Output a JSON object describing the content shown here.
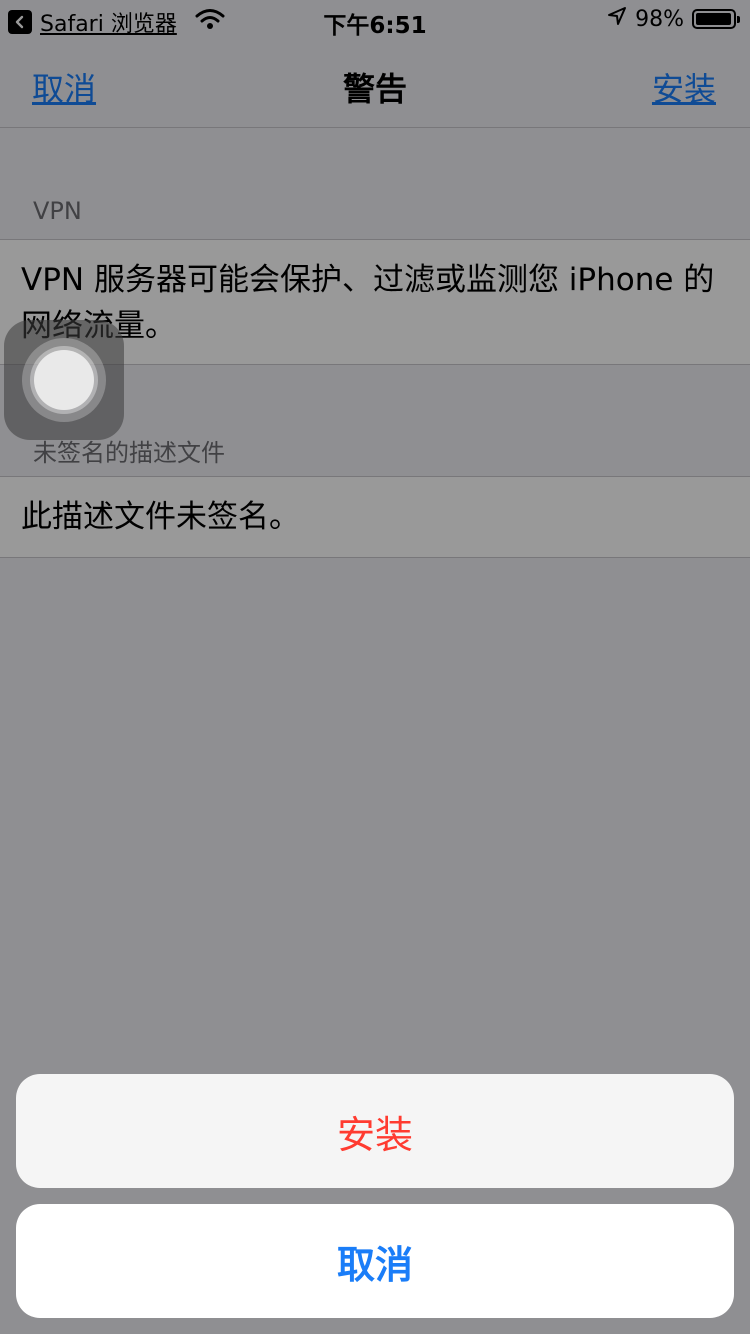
{
  "status_bar": {
    "back_app": "Safari 浏览器",
    "time": "下午6:51",
    "battery_text": "98%",
    "battery_level": 0.98
  },
  "nav": {
    "cancel": "取消",
    "title": "警告",
    "install": "安装"
  },
  "sections": [
    {
      "header": "VPN",
      "text": "VPN 服务器可能会保护、过滤或监测您 iPhone 的网络流量。"
    },
    {
      "header": "未签名的描述文件",
      "text": "此描述文件未签名。"
    }
  ],
  "action_sheet": {
    "install": "安装",
    "cancel": "取消"
  },
  "colors": {
    "link_blue": "#1a7df8",
    "destructive_red": "#ff3b30"
  }
}
